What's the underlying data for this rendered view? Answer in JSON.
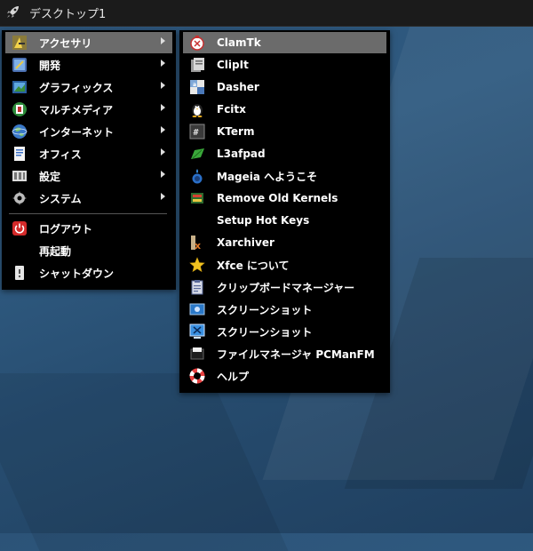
{
  "panel": {
    "title": "デスクトップ1",
    "launcher_icon": "rocket-icon"
  },
  "main_menu": {
    "items": [
      {
        "label": "アクセサリ",
        "icon": "accessories-icon",
        "submenu": true,
        "active": true
      },
      {
        "label": "開発",
        "icon": "development-icon",
        "submenu": true
      },
      {
        "label": "グラフィックス",
        "icon": "graphics-icon",
        "submenu": true
      },
      {
        "label": "マルチメディア",
        "icon": "multimedia-icon",
        "submenu": true
      },
      {
        "label": "インターネット",
        "icon": "internet-icon",
        "submenu": true
      },
      {
        "label": "オフィス",
        "icon": "office-icon",
        "submenu": true
      },
      {
        "label": "設定",
        "icon": "settings-icon",
        "submenu": true
      },
      {
        "label": "システム",
        "icon": "system-icon",
        "submenu": true
      }
    ],
    "session": [
      {
        "label": "ログアウト",
        "icon": "logout-icon"
      },
      {
        "label": "再起動",
        "icon": ""
      },
      {
        "label": "シャットダウン",
        "icon": "shutdown-icon"
      }
    ]
  },
  "accessories_submenu": {
    "items": [
      {
        "label": "ClamTk",
        "icon": "clamtk-icon"
      },
      {
        "label": "ClipIt",
        "icon": "clipit-icon"
      },
      {
        "label": "Dasher",
        "icon": "dasher-icon"
      },
      {
        "label": "Fcitx",
        "icon": "penguin-icon"
      },
      {
        "label": "KTerm",
        "icon": "terminal-icon"
      },
      {
        "label": "L3afpad",
        "icon": "leaf-icon"
      },
      {
        "label": "Mageia へようこそ",
        "icon": "mageia-icon"
      },
      {
        "label": "Remove Old Kernels",
        "icon": "kernel-icon"
      },
      {
        "label": "Setup Hot Keys",
        "icon": ""
      },
      {
        "label": "Xarchiver",
        "icon": "archive-icon"
      },
      {
        "label": "Xfce について",
        "icon": "star-icon"
      },
      {
        "label": "クリップボードマネージャー",
        "icon": "clipboard-icon"
      },
      {
        "label": "スクリーンショット",
        "icon": "screenshot-icon"
      },
      {
        "label": "スクリーンショット",
        "icon": "screenshot-icon"
      },
      {
        "label": "ファイルマネージャ PCManFM",
        "icon": "file-manager-icon"
      },
      {
        "label": "ヘルプ",
        "icon": "help-lifebuoy-icon"
      }
    ]
  },
  "colors": {
    "menu_bg": "#000000",
    "highlight": "#6b6b6b",
    "panel_bg": "#1b1b1b",
    "desktop": "#2c5378"
  }
}
